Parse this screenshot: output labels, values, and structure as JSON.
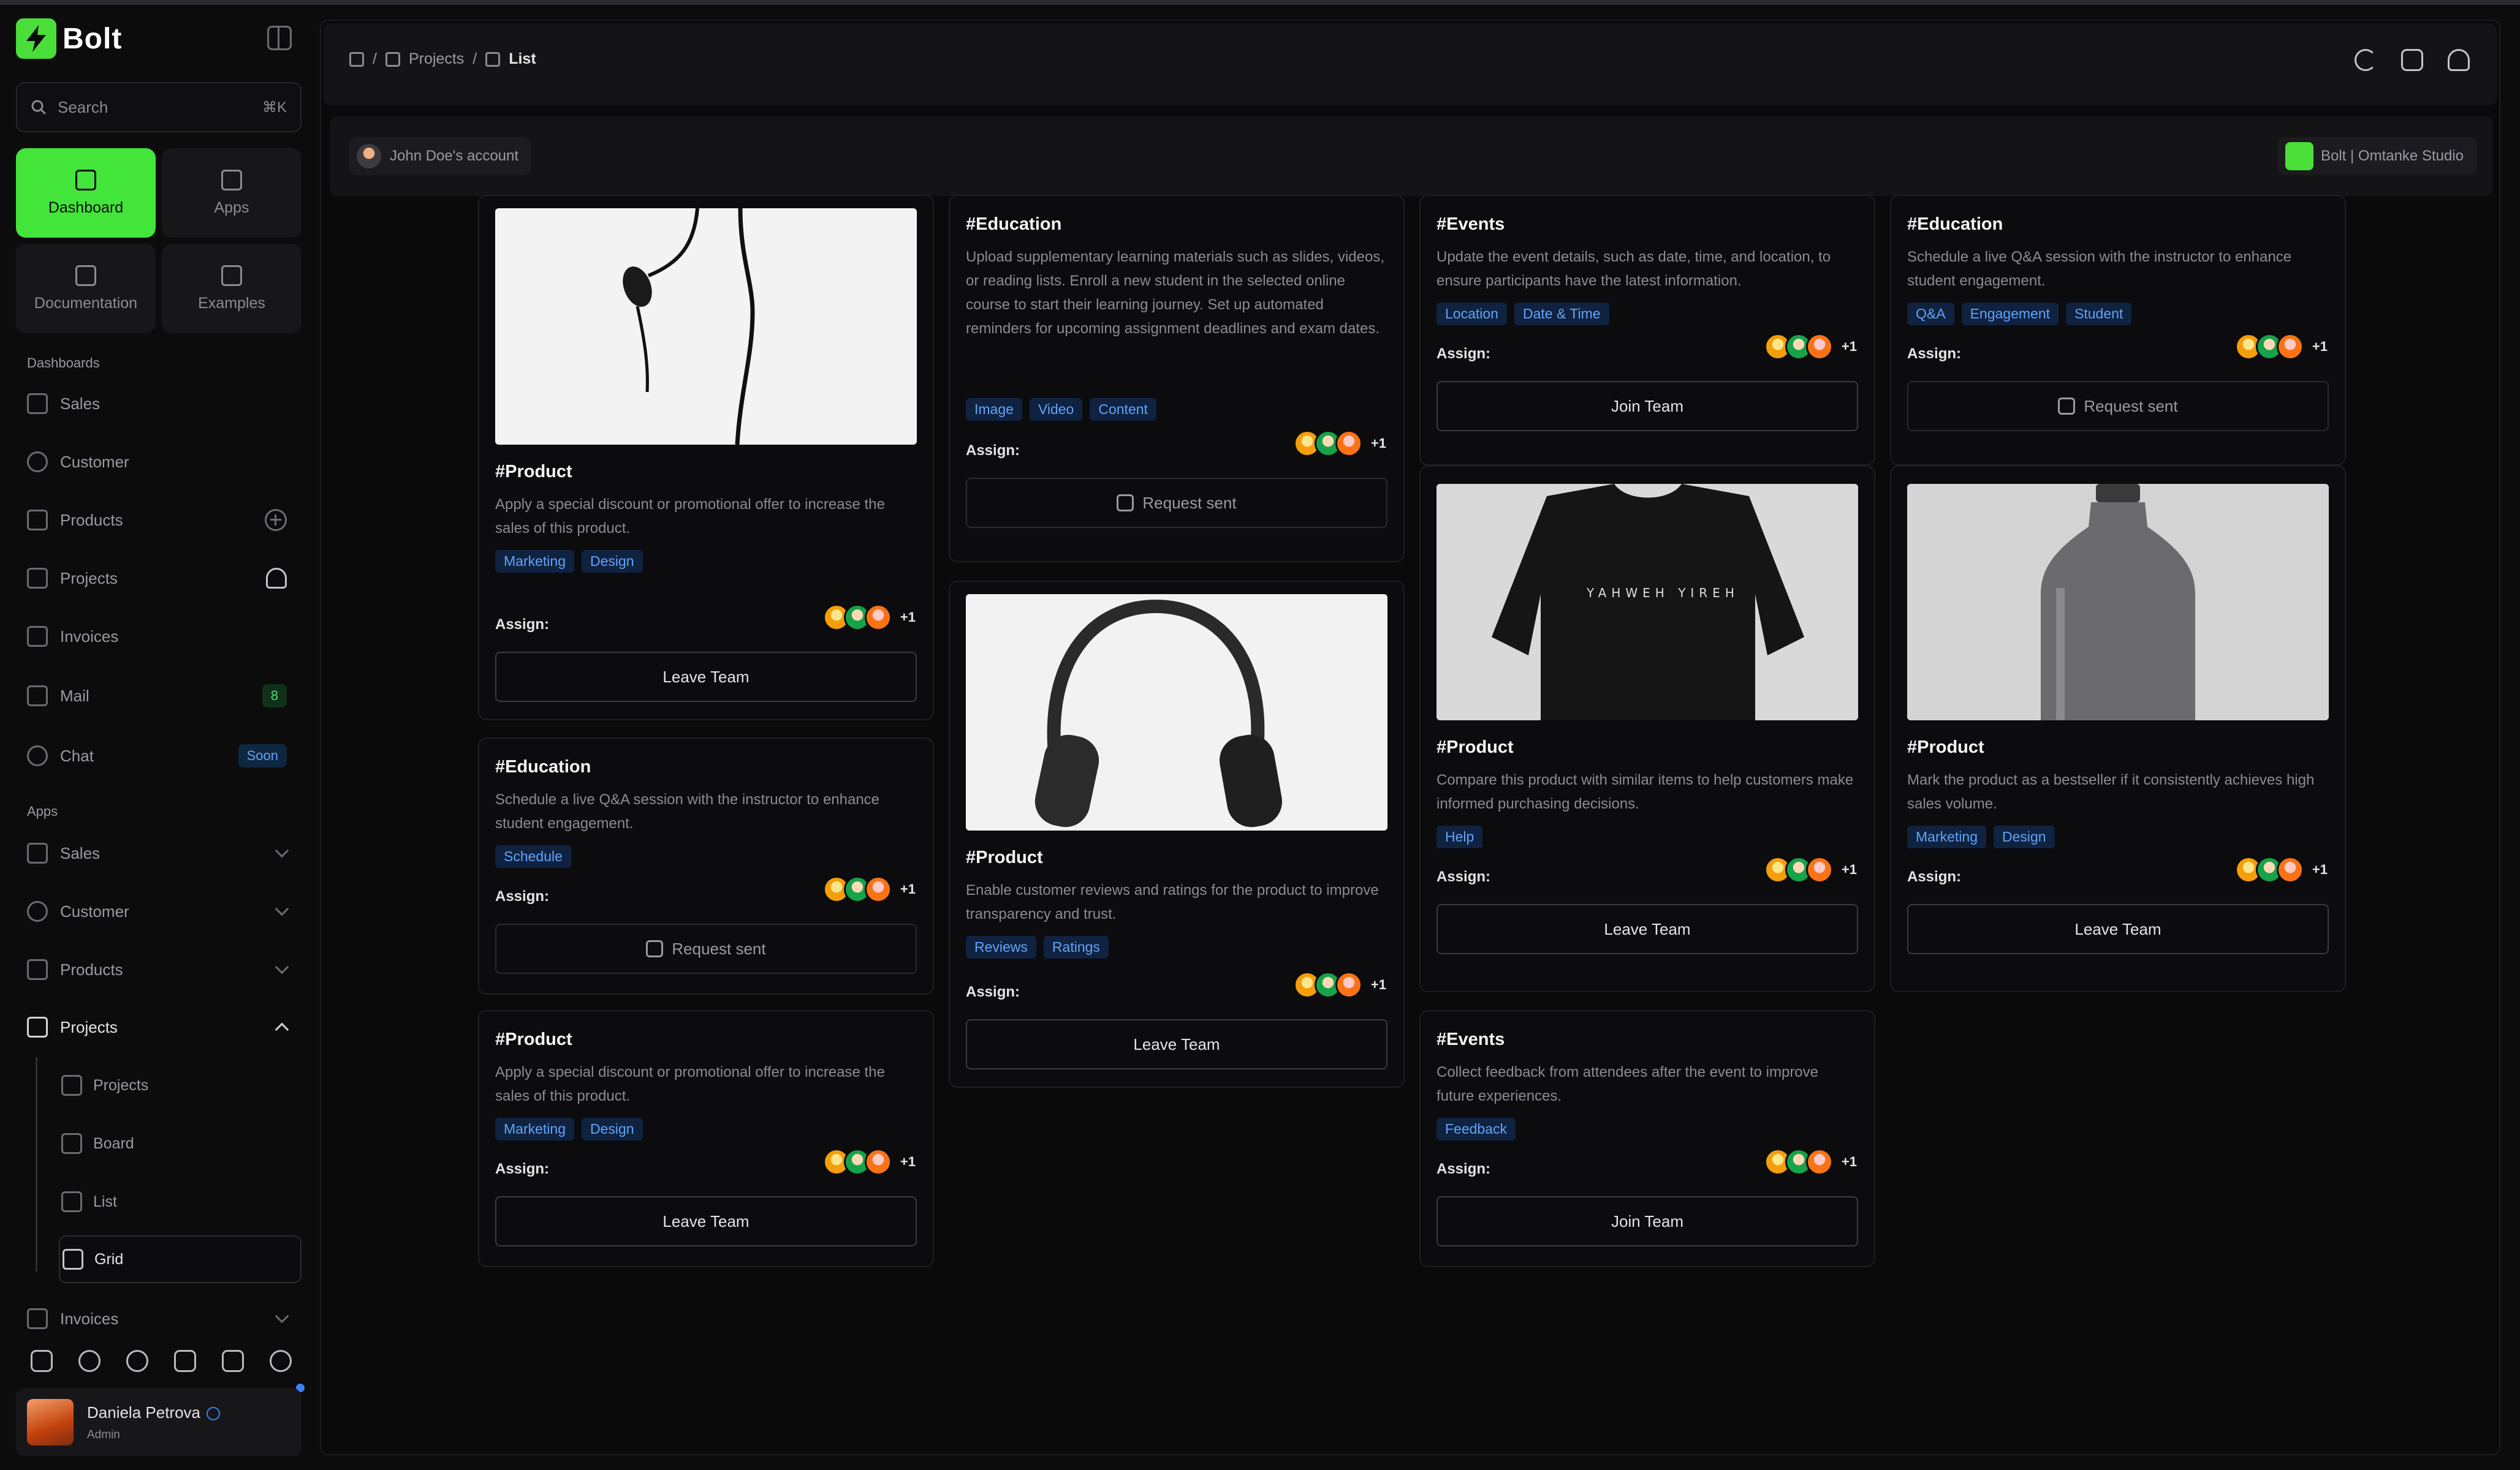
{
  "app": {
    "name": "Bolt"
  },
  "sidebar": {
    "search": {
      "placeholder": "Search",
      "shortcut": "⌘K"
    },
    "tiles": [
      {
        "label": "Dashboard",
        "active": true,
        "icon": "home-icon"
      },
      {
        "label": "Apps",
        "icon": "grid-icon"
      },
      {
        "label": "Documentation",
        "icon": "document-icon"
      },
      {
        "label": "Examples",
        "icon": "star-icon"
      }
    ],
    "dashboards_label": "Dashboards",
    "dashboards": [
      {
        "label": "Sales",
        "icon": "sales-icon"
      },
      {
        "label": "Customer",
        "icon": "users-icon"
      },
      {
        "label": "Products",
        "icon": "box-icon"
      },
      {
        "label": "Projects",
        "icon": "projects-icon"
      },
      {
        "label": "Invoices",
        "icon": "invoice-icon"
      },
      {
        "label": "Mail",
        "icon": "mail-icon",
        "badge": "8"
      },
      {
        "label": "Chat",
        "icon": "chat-icon",
        "badge": "Soon"
      }
    ],
    "apps_label": "Apps",
    "apps": [
      {
        "label": "Sales",
        "icon": "sales-icon"
      },
      {
        "label": "Customer",
        "icon": "users-icon"
      },
      {
        "label": "Products",
        "icon": "box-icon"
      },
      {
        "label": "Projects",
        "icon": "projects-icon",
        "expanded": true
      },
      {
        "label": "Invoices",
        "icon": "invoice-icon"
      }
    ],
    "project_sub": [
      {
        "label": "Projects"
      },
      {
        "label": "Board"
      },
      {
        "label": "List"
      },
      {
        "label": "Grid",
        "active": true
      }
    ],
    "user": {
      "name": "Daniela Petrova",
      "role": "Admin"
    }
  },
  "header": {
    "breadcrumb": [
      {
        "label": "Projects"
      },
      {
        "label": "List"
      }
    ],
    "separator": "/"
  },
  "account": {
    "label": "John Doe's account",
    "studio": "Bolt | Omtanke Studio"
  },
  "assign_label": "Assign:",
  "cards": [
    {
      "tag": "#Product",
      "photo": "earphones",
      "desc": "Apply a special discount or promotional offer to increase the sales of this product.",
      "tags": [
        "Marketing",
        "Design"
      ],
      "more": "+1",
      "action": "Leave Team"
    },
    {
      "tag": "#Education",
      "desc": "Schedule a live Q&A session with the instructor to enhance student engagement.",
      "tags": [
        "Schedule"
      ],
      "more": "+1",
      "action": "Request sent"
    },
    {
      "tag": "#Product",
      "desc": "Apply a special discount or promotional offer to increase the sales of this product.",
      "tags": [
        "Marketing",
        "Design"
      ],
      "more": "+1",
      "action": "Leave Team"
    },
    {
      "tag": "#Education",
      "desc": "Upload supplementary learning materials such as slides, videos, or reading lists. Enroll a new student in the selected online course to start their learning journey. Set up automated reminders for upcoming assignment deadlines and exam dates.",
      "tags": [
        "Image",
        "Video",
        "Content"
      ],
      "more": "+1",
      "action": "Request sent"
    },
    {
      "tag": "#Product",
      "photo": "headphones",
      "desc": "Enable customer reviews and ratings for the product to improve transparency and trust.",
      "tags": [
        "Reviews",
        "Ratings"
      ],
      "more": "+1",
      "action": "Leave Team"
    },
    {
      "tag": "#Events",
      "desc": "Update the event details, such as date, time, and location, to ensure participants have the latest information.",
      "tags": [
        "Location",
        "Date & Time"
      ],
      "more": "+1",
      "action": "Join Team"
    },
    {
      "tag": "#Product",
      "photo": "tshirt",
      "desc": "Compare this product with similar items to help customers make informed purchasing decisions.",
      "tags": [
        "Help"
      ],
      "more": "+1",
      "action": "Leave Team"
    },
    {
      "tag": "#Events",
      "desc": "Collect feedback from attendees after the event to improve future experiences.",
      "tags": [
        "Feedback"
      ],
      "more": "+1",
      "action": "Join Team"
    },
    {
      "tag": "#Education",
      "desc": "Schedule a live Q&A session with the instructor to enhance student engagement.",
      "tags": [
        "Q&A",
        "Engagement",
        "Student"
      ],
      "more": "+1",
      "action": "Request sent"
    },
    {
      "tag": "#Product",
      "photo": "bottle",
      "desc": "Mark the product as a bestseller if it consistently achieves high sales volume.",
      "tags": [
        "Marketing",
        "Design"
      ],
      "more": "+1",
      "action": "Leave Team"
    }
  ],
  "photo_text": "YAHWEH YIREH",
  "colors": {
    "accent": "#43e53a",
    "tag_text": "#60a5fa",
    "tag_bg": "#0f2240",
    "background": "#0c0c0d"
  }
}
